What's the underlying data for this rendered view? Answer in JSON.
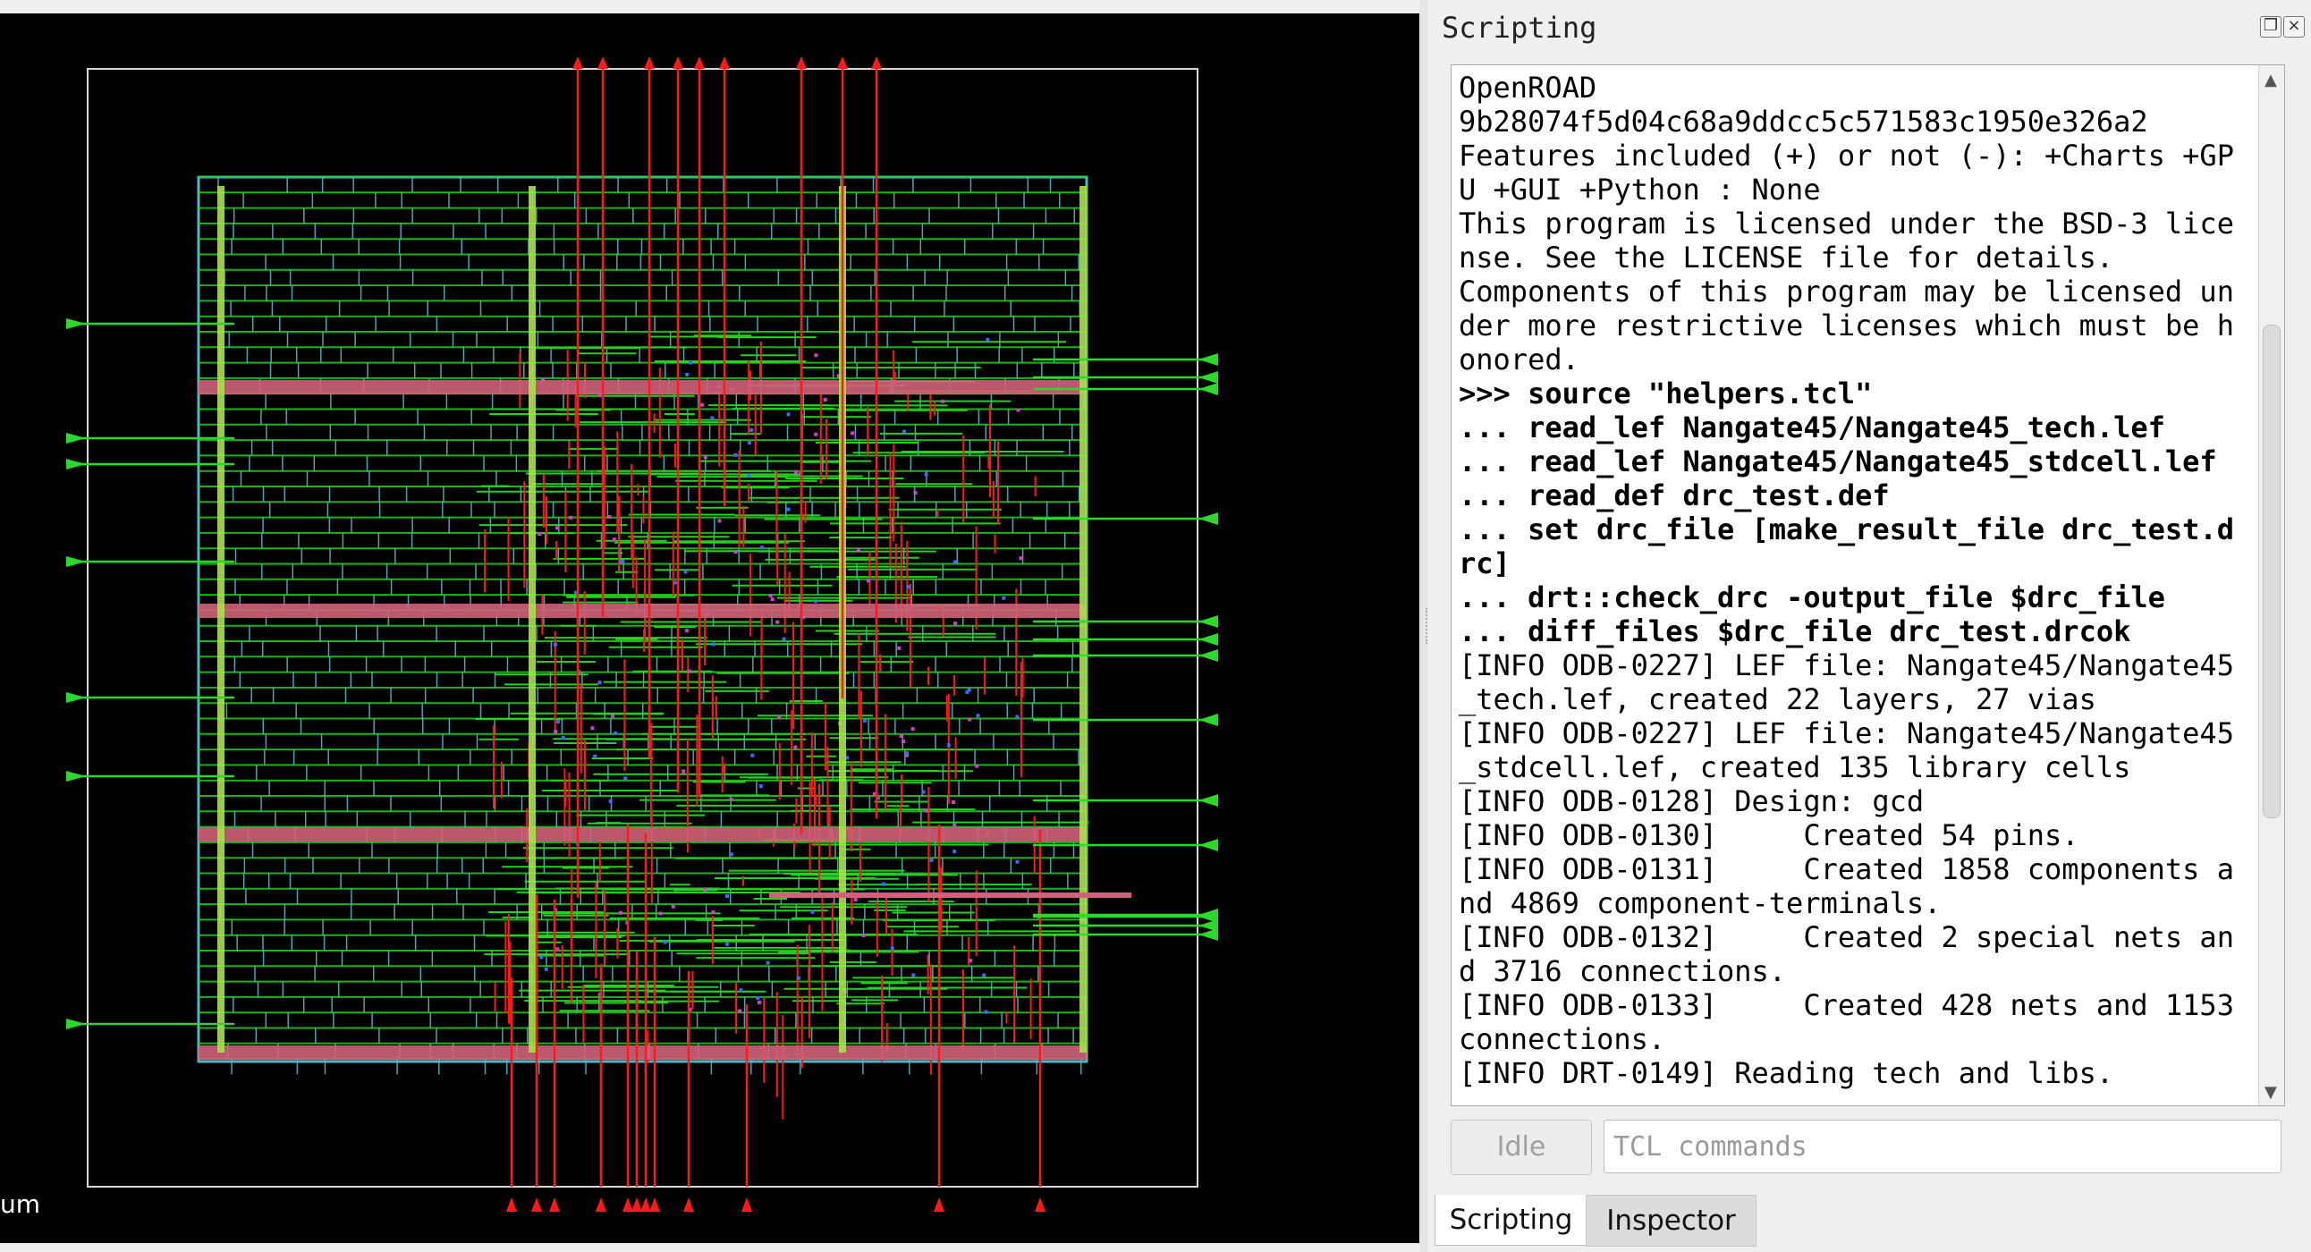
{
  "layout_view": {
    "scale_label": "um",
    "colors": {
      "background": "#000000",
      "die_outline": "#d8d8d8",
      "row_lines": "#4db8c8",
      "metal_horizontal": "#22d41e",
      "metal_vertical": "#ff1a1a",
      "power_rails": "#d2607a",
      "power_stripes": "#a8e24a",
      "pins": "#2bd92b"
    }
  },
  "dock": {
    "title": "Scripting",
    "float_icon": "float-icon",
    "close_icon": "close-icon"
  },
  "output": {
    "lines": [
      "OpenROAD",
      "9b28074f5d04c68a9ddcc5c571583c1950e326a2",
      "Features included (+) or not (-): +Charts +GPU +GUI +Python : None",
      "This program is licensed under the BSD-3 license. See the LICENSE file for details.",
      "Components of this program may be licensed under more restrictive licenses which must be honored.",
      ">>> source \"helpers.tcl\"",
      "... read_lef Nangate45/Nangate45_tech.lef",
      "... read_lef Nangate45/Nangate45_stdcell.lef",
      "... read_def drc_test.def",
      "... set drc_file [make_result_file drc_test.drc]",
      "... drt::check_drc -output_file $drc_file",
      "... diff_files $drc_file drc_test.drcok",
      "[INFO ODB-0227] LEF file: Nangate45/Nangate45_tech.lef, created 22 layers, 27 vias",
      "[INFO ODB-0227] LEF file: Nangate45/Nangate45_stdcell.lef, created 135 library cells",
      "[INFO ODB-0128] Design: gcd",
      "[INFO ODB-0130]     Created 54 pins.",
      "[INFO ODB-0131]     Created 1858 components and 4869 component-terminals.",
      "[INFO ODB-0132]     Created 2 special nets and 3716 connections.",
      "[INFO ODB-0133]     Created 428 nets and 1153 connections.",
      "[INFO DRT-0149] Reading tech and libs."
    ]
  },
  "controls": {
    "status_button": "Idle",
    "command_placeholder": "TCL commands"
  },
  "tabs": {
    "scripting": "Scripting",
    "inspector": "Inspector"
  }
}
